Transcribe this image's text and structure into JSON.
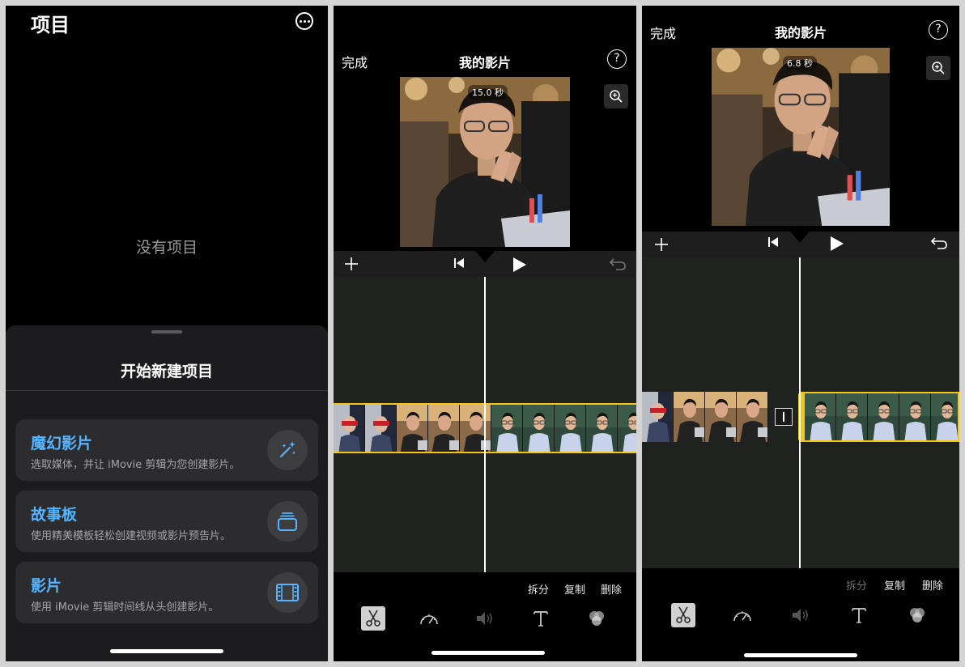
{
  "projects_screen": {
    "title": "项目",
    "empty_text": "没有项目",
    "sheet_title": "开始新建项目",
    "options": [
      {
        "title": "魔幻影片",
        "desc": "选取媒体，并让 iMovie 剪辑为您创建影片。",
        "icon": "magic-wand-icon"
      },
      {
        "title": "故事板",
        "desc": "使用精美模板轻松创建视频或影片预告片。",
        "icon": "storyboard-icon"
      },
      {
        "title": "影片",
        "desc": "使用 iMovie 剪辑时间线从头创建影片。",
        "icon": "film-icon"
      }
    ]
  },
  "editor1": {
    "done": "完成",
    "title": "我的影片",
    "help": "?",
    "duration": "15.0 秒",
    "actions": {
      "split": "拆分",
      "duplicate": "复制",
      "delete": "删除"
    }
  },
  "editor2": {
    "done": "完成",
    "title": "我的影片",
    "help": "?",
    "duration": "6.8 秒",
    "actions": {
      "split": "拆分",
      "duplicate": "复制",
      "delete": "删除"
    }
  },
  "colors": {
    "accent_blue": "#55b5ff",
    "clip_highlight": "#f5c518",
    "timeline_bg": "#202220"
  }
}
